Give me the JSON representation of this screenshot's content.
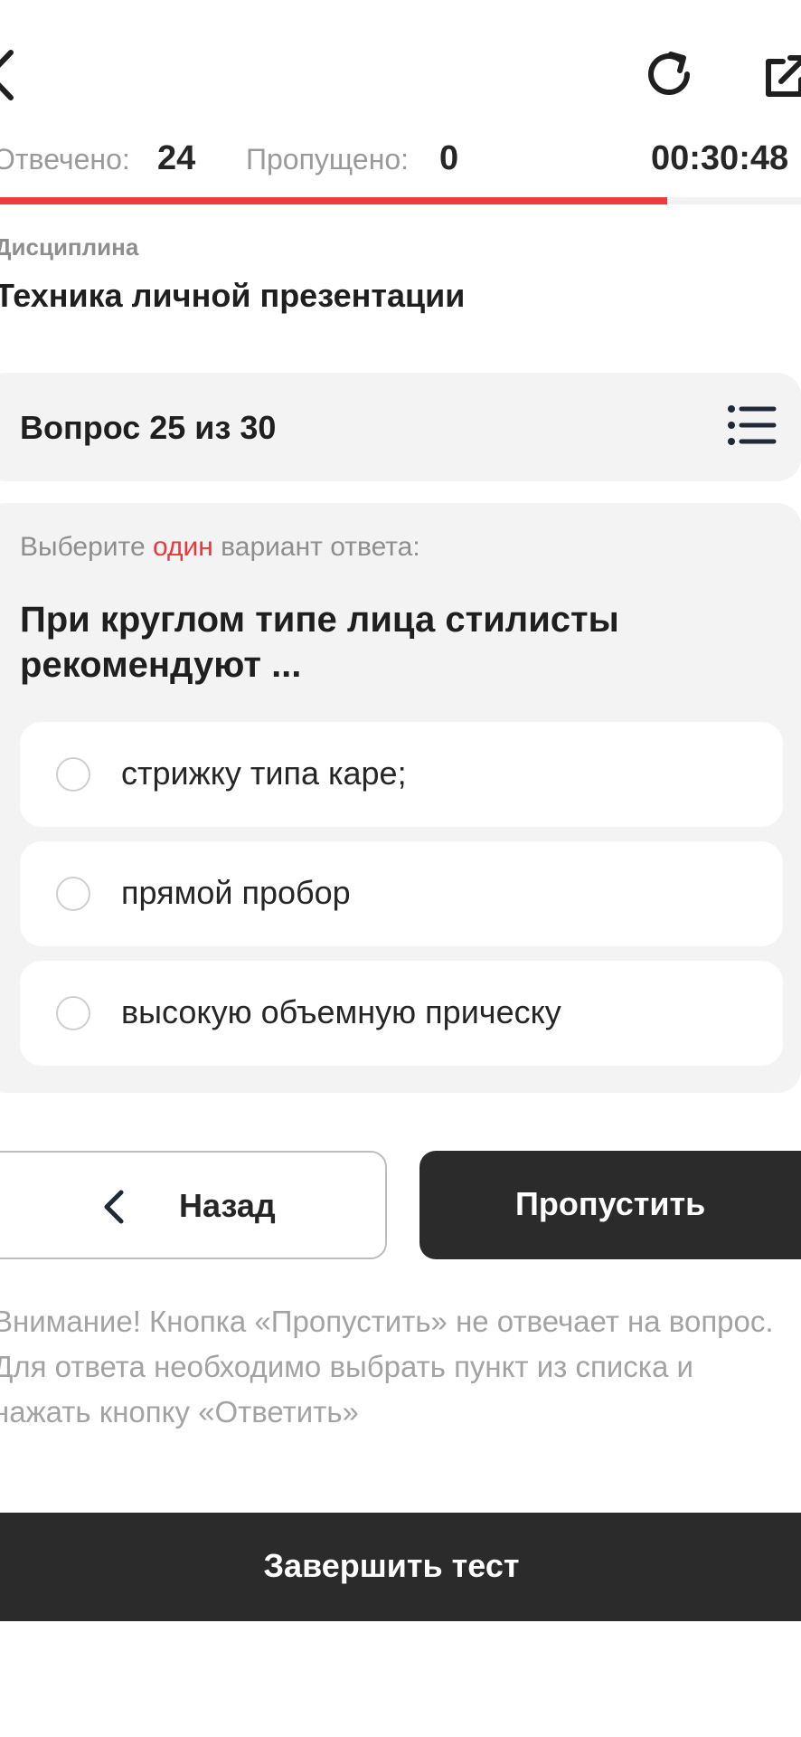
{
  "stats": {
    "answered_label": "Отвечено:",
    "answered_value": "24",
    "skipped_label": "Пропущено:",
    "skipped_value": "0",
    "timer": "00:30:48"
  },
  "progress": {
    "fraction": 0.833,
    "color": "#ee3a3a"
  },
  "discipline": {
    "label": "Дисциплина",
    "title": "Техника личной презентации"
  },
  "question_header": {
    "label": "Вопрос 25 из 30"
  },
  "question": {
    "instruction_before": "Выберите ",
    "instruction_accent": "один",
    "instruction_after": " вариант ответа:",
    "text": "При круглом типе лица стилисты рекомендуют ...",
    "options": [
      {
        "label": "стрижку типа каре;"
      },
      {
        "label": "прямой пробор"
      },
      {
        "label": "высокую объемную прическу"
      }
    ]
  },
  "buttons": {
    "back": "Назад",
    "skip": "Пропустить",
    "finish": "Завершить тест"
  },
  "notice": "Внимание! Кнопка «Пропустить» не отвечает на вопрос. Для ответа необходимо выбрать пункт из списка и нажать кнопку «Ответить»",
  "icons": {
    "back": "chevron-left-icon",
    "refresh": "refresh-icon",
    "external": "external-link-icon",
    "list": "list-icon"
  },
  "colors": {
    "accent": "#e63a3a",
    "dark_button": "#2b2b2b",
    "card_bg": "#f3f3f3"
  }
}
